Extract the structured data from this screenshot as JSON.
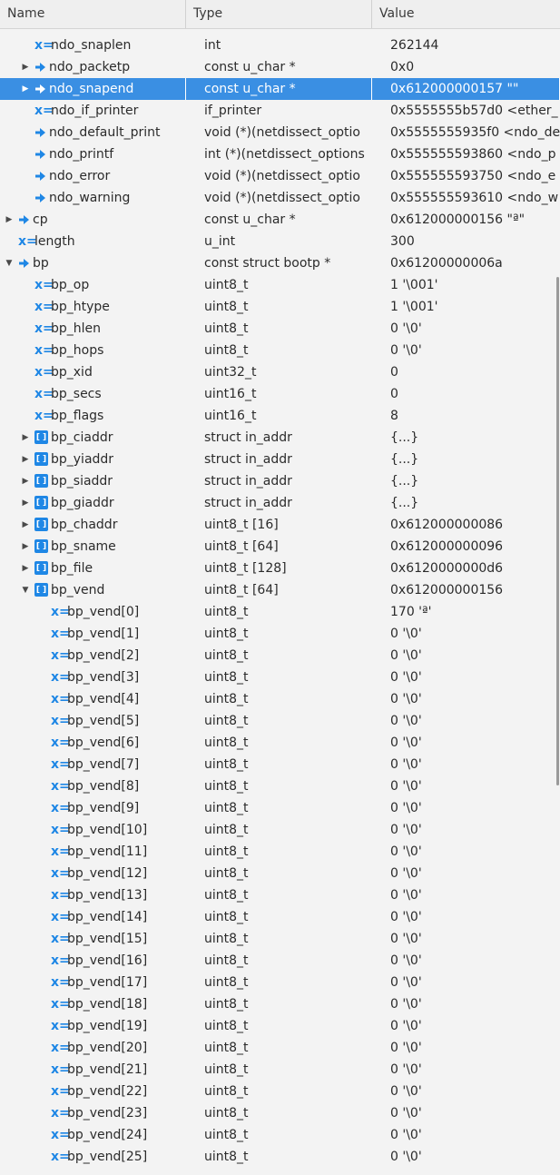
{
  "header": {
    "name": "Name",
    "type": "Type",
    "value": "Value"
  },
  "rows": [
    {
      "name": "ndo_snaplen",
      "depth": 2,
      "kind": "x",
      "expand": "none",
      "type": "int",
      "value": "262144"
    },
    {
      "name": "ndo_packetp",
      "depth": 2,
      "kind": "ptr",
      "expand": "closed",
      "type": "const u_char *",
      "value": "0x0"
    },
    {
      "name": "ndo_snapend",
      "depth": 2,
      "kind": "ptr",
      "expand": "closed",
      "type": "const u_char *",
      "value": "0x612000000157 \"\"",
      "selected": true
    },
    {
      "name": "ndo_if_printer",
      "depth": 2,
      "kind": "x",
      "expand": "none",
      "type": "if_printer",
      "value": "0x5555555b57d0 <ether_"
    },
    {
      "name": "ndo_default_print",
      "depth": 2,
      "kind": "ptr",
      "expand": "none",
      "type": "void (*)(netdissect_optio",
      "value": "0x5555555935f0 <ndo_de"
    },
    {
      "name": "ndo_printf",
      "depth": 2,
      "kind": "ptr",
      "expand": "none",
      "type": "int (*)(netdissect_options",
      "value": "0x555555593860 <ndo_p"
    },
    {
      "name": "ndo_error",
      "depth": 2,
      "kind": "ptr",
      "expand": "none",
      "type": "void (*)(netdissect_optio",
      "value": "0x555555593750 <ndo_e"
    },
    {
      "name": "ndo_warning",
      "depth": 2,
      "kind": "ptr",
      "expand": "none",
      "type": "void (*)(netdissect_optio",
      "value": "0x555555593610 <ndo_w"
    },
    {
      "name": "cp",
      "depth": 1,
      "kind": "ptr",
      "expand": "closed",
      "type": "const u_char *",
      "value": "0x612000000156 \"ª\""
    },
    {
      "name": "length",
      "depth": 1,
      "kind": "x",
      "expand": "none",
      "type": "u_int",
      "value": "300"
    },
    {
      "name": "bp",
      "depth": 1,
      "kind": "ptr",
      "expand": "open",
      "type": "const struct bootp *",
      "value": "0x61200000006a"
    },
    {
      "name": "bp_op",
      "depth": 2,
      "kind": "x",
      "expand": "none",
      "type": "uint8_t",
      "value": "1 '\\001'"
    },
    {
      "name": "bp_htype",
      "depth": 2,
      "kind": "x",
      "expand": "none",
      "type": "uint8_t",
      "value": "1 '\\001'"
    },
    {
      "name": "bp_hlen",
      "depth": 2,
      "kind": "x",
      "expand": "none",
      "type": "uint8_t",
      "value": "0 '\\0'"
    },
    {
      "name": "bp_hops",
      "depth": 2,
      "kind": "x",
      "expand": "none",
      "type": "uint8_t",
      "value": "0 '\\0'"
    },
    {
      "name": "bp_xid",
      "depth": 2,
      "kind": "x",
      "expand": "none",
      "type": "uint32_t",
      "value": "0"
    },
    {
      "name": "bp_secs",
      "depth": 2,
      "kind": "x",
      "expand": "none",
      "type": "uint16_t",
      "value": "0"
    },
    {
      "name": "bp_flags",
      "depth": 2,
      "kind": "x",
      "expand": "none",
      "type": "uint16_t",
      "value": "8"
    },
    {
      "name": "bp_ciaddr",
      "depth": 2,
      "kind": "struct",
      "expand": "closed",
      "type": "struct in_addr",
      "value": "{...}"
    },
    {
      "name": "bp_yiaddr",
      "depth": 2,
      "kind": "struct",
      "expand": "closed",
      "type": "struct in_addr",
      "value": "{...}"
    },
    {
      "name": "bp_siaddr",
      "depth": 2,
      "kind": "struct",
      "expand": "closed",
      "type": "struct in_addr",
      "value": "{...}"
    },
    {
      "name": "bp_giaddr",
      "depth": 2,
      "kind": "struct",
      "expand": "closed",
      "type": "struct in_addr",
      "value": "{...}"
    },
    {
      "name": "bp_chaddr",
      "depth": 2,
      "kind": "struct",
      "expand": "closed",
      "type": "uint8_t [16]",
      "value": "0x612000000086"
    },
    {
      "name": "bp_sname",
      "depth": 2,
      "kind": "struct",
      "expand": "closed",
      "type": "uint8_t [64]",
      "value": "0x612000000096"
    },
    {
      "name": "bp_file",
      "depth": 2,
      "kind": "struct",
      "expand": "closed",
      "type": "uint8_t [128]",
      "value": "0x6120000000d6"
    },
    {
      "name": "bp_vend",
      "depth": 2,
      "kind": "struct",
      "expand": "open",
      "type": "uint8_t [64]",
      "value": "0x612000000156"
    },
    {
      "name": "bp_vend[0]",
      "depth": 3,
      "kind": "x",
      "expand": "none",
      "type": "uint8_t",
      "value": "170 'ª'"
    },
    {
      "name": "bp_vend[1]",
      "depth": 3,
      "kind": "x",
      "expand": "none",
      "type": "uint8_t",
      "value": "0 '\\0'"
    },
    {
      "name": "bp_vend[2]",
      "depth": 3,
      "kind": "x",
      "expand": "none",
      "type": "uint8_t",
      "value": "0 '\\0'"
    },
    {
      "name": "bp_vend[3]",
      "depth": 3,
      "kind": "x",
      "expand": "none",
      "type": "uint8_t",
      "value": "0 '\\0'"
    },
    {
      "name": "bp_vend[4]",
      "depth": 3,
      "kind": "x",
      "expand": "none",
      "type": "uint8_t",
      "value": "0 '\\0'"
    },
    {
      "name": "bp_vend[5]",
      "depth": 3,
      "kind": "x",
      "expand": "none",
      "type": "uint8_t",
      "value": "0 '\\0'"
    },
    {
      "name": "bp_vend[6]",
      "depth": 3,
      "kind": "x",
      "expand": "none",
      "type": "uint8_t",
      "value": "0 '\\0'"
    },
    {
      "name": "bp_vend[7]",
      "depth": 3,
      "kind": "x",
      "expand": "none",
      "type": "uint8_t",
      "value": "0 '\\0'"
    },
    {
      "name": "bp_vend[8]",
      "depth": 3,
      "kind": "x",
      "expand": "none",
      "type": "uint8_t",
      "value": "0 '\\0'"
    },
    {
      "name": "bp_vend[9]",
      "depth": 3,
      "kind": "x",
      "expand": "none",
      "type": "uint8_t",
      "value": "0 '\\0'"
    },
    {
      "name": "bp_vend[10]",
      "depth": 3,
      "kind": "x",
      "expand": "none",
      "type": "uint8_t",
      "value": "0 '\\0'"
    },
    {
      "name": "bp_vend[11]",
      "depth": 3,
      "kind": "x",
      "expand": "none",
      "type": "uint8_t",
      "value": "0 '\\0'"
    },
    {
      "name": "bp_vend[12]",
      "depth": 3,
      "kind": "x",
      "expand": "none",
      "type": "uint8_t",
      "value": "0 '\\0'"
    },
    {
      "name": "bp_vend[13]",
      "depth": 3,
      "kind": "x",
      "expand": "none",
      "type": "uint8_t",
      "value": "0 '\\0'"
    },
    {
      "name": "bp_vend[14]",
      "depth": 3,
      "kind": "x",
      "expand": "none",
      "type": "uint8_t",
      "value": "0 '\\0'"
    },
    {
      "name": "bp_vend[15]",
      "depth": 3,
      "kind": "x",
      "expand": "none",
      "type": "uint8_t",
      "value": "0 '\\0'"
    },
    {
      "name": "bp_vend[16]",
      "depth": 3,
      "kind": "x",
      "expand": "none",
      "type": "uint8_t",
      "value": "0 '\\0'"
    },
    {
      "name": "bp_vend[17]",
      "depth": 3,
      "kind": "x",
      "expand": "none",
      "type": "uint8_t",
      "value": "0 '\\0'"
    },
    {
      "name": "bp_vend[18]",
      "depth": 3,
      "kind": "x",
      "expand": "none",
      "type": "uint8_t",
      "value": "0 '\\0'"
    },
    {
      "name": "bp_vend[19]",
      "depth": 3,
      "kind": "x",
      "expand": "none",
      "type": "uint8_t",
      "value": "0 '\\0'"
    },
    {
      "name": "bp_vend[20]",
      "depth": 3,
      "kind": "x",
      "expand": "none",
      "type": "uint8_t",
      "value": "0 '\\0'"
    },
    {
      "name": "bp_vend[21]",
      "depth": 3,
      "kind": "x",
      "expand": "none",
      "type": "uint8_t",
      "value": "0 '\\0'"
    },
    {
      "name": "bp_vend[22]",
      "depth": 3,
      "kind": "x",
      "expand": "none",
      "type": "uint8_t",
      "value": "0 '\\0'"
    },
    {
      "name": "bp_vend[23]",
      "depth": 3,
      "kind": "x",
      "expand": "none",
      "type": "uint8_t",
      "value": "0 '\\0'"
    },
    {
      "name": "bp_vend[24]",
      "depth": 3,
      "kind": "x",
      "expand": "none",
      "type": "uint8_t",
      "value": "0 '\\0'"
    },
    {
      "name": "bp_vend[25]",
      "depth": 3,
      "kind": "x",
      "expand": "none",
      "type": "uint8_t",
      "value": "0 '\\0'"
    }
  ],
  "colors": {
    "accent": "#1f87e5",
    "selection": "#3a8fe3"
  }
}
